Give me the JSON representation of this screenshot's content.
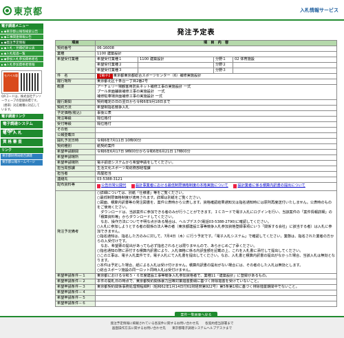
{
  "header": {
    "org": "東京都",
    "service": "入札情報サービス"
  },
  "sidebar": {
    "section1": "電子調達メニュー",
    "items": [
      "◆東京都公報等検索公告",
      "◆工事関連情報公告",
      "◆発注予定情報",
      "◆入札・見積結果公表",
      "◆入札経過一覧",
      "◆参加入札参加資格者名",
      "◆入札参加資格者情報"
    ],
    "mobile_logo": "モバイル版",
    "mobile_text": "QRコードは、株式会社デンソーウェーブの登録商標です。（携帯）対応機種に対応しています。",
    "section2": "電子調達リンク",
    "buttons": [
      "電子調達システム(TOP)",
      "電 子 入 札",
      "資 格 審 査"
    ],
    "section3": "リンク",
    "links": [
      "東京都財務局総合調達",
      "東京都公報ホームページ"
    ]
  },
  "page_title": "発注予定表",
  "table_head": {
    "c1": "項目",
    "c2": "項　目　内　容"
  },
  "rows": {
    "contract_no": {
      "label": "契約番号",
      "value": "06-16008"
    },
    "category": {
      "label": "業種",
      "value": "1100 建築設計"
    },
    "desired": {
      "label": "希望受付業種",
      "r1": "希望受付業種１",
      "r1v": "1100 建築設計",
      "r2": "希望受付業種２",
      "r3": "希望受付業種３",
      "p1": "分野１",
      "p1v": "02 体育施設",
      "p2": "分野２",
      "p3": "分野３"
    },
    "name": {
      "label": "件　名",
      "tag": "【電子】",
      "value": "東京都東京都総合スポーツセンター（6）補修実施設計"
    },
    "place": {
      "label": "履行場所",
      "value": "東京都北区十条台一丁目2番2号"
    },
    "summary": {
      "label": "概要",
      "l1": "アーチェリー場観客用防失ネット補修工事の実施設計 一式",
      "l2": "プール床面舗装補修工事の実施設計　一式",
      "l3": "補修駐車場床面補修工事の実施設計 一式"
    },
    "period": {
      "label": "履行期間",
      "value": "契約確定の日の翌日から令和6年9月18日まで"
    },
    "method": {
      "label": "契約方法",
      "value": "希望制指名競争入札"
    },
    "price_type": {
      "label": "予定価格(税込)",
      "value": "事後公表"
    },
    "announce": {
      "label": "発注等級",
      "value": "隔位格付"
    },
    "ordering": {
      "label": "受付等級",
      "value": "隔位格付"
    },
    "other": {
      "label": "その他",
      "value": ""
    },
    "pub_date": {
      "label": "公報登載日",
      "value": ""
    },
    "open_date": {
      "label": "開札予定日時",
      "value": "令和6年7月11日 10時00分"
    },
    "bid_type": {
      "label": "契約種別",
      "value": "紙契約案件"
    },
    "apply_period": {
      "label": "希望申請期間",
      "value": "令和6年6月17日 9時00分から令和6年6月21日 17時00分"
    },
    "apply_place": {
      "label": "希望申請場所",
      "value": ""
    },
    "apply_method": {
      "label": "希望申請場所",
      "value": "電子調達システムから希望申請をしてください。"
    },
    "dept": {
      "label": "担当局部課",
      "value": "生活文化スポーツ局総務部経理課"
    },
    "contact": {
      "label": "担当者",
      "value": "周屋担当"
    },
    "tel": {
      "label": "連絡先",
      "value": "03-5388-3121"
    },
    "docs": {
      "label": "配布資料等",
      "d1": "公告日常公開代",
      "d2": "設計事業者における最低制限価格制度の本格実施について",
      "d3": "設計業者に係る積算内訳書の提出について"
    },
    "notes": {
      "label": "発注予定備考",
      "lines": [
        "○詳細については、別紙「仕様書」等をご覧ください。",
        "○最低制限価格制度が適用されます。詳細は別紙をご覧ください。",
        "○図面、積算内訳書等の発注図書を、案件公表時から公表します。資格確認結果通知又は指名通知時には原則再度送付いたしません。公表時のものをご使用ください。",
        "　ダウンロードは、当該案件に参加できる者のみが行うことができます。ＩＣカードで電子入札にログインを行い、当該案件の「案件情報詳細」の「積算資料等」からダウンロードしてください。",
        "　なお、操作方法について不明な点がある場合は、ヘルプデスク(電話03-5388-2790)に確認してください。",
        "○入札に参加しようとする者の関係の法人等の者（東京都建設工事等競争入札参加資格登録事項にいう「関係する会社」に該当する者）は入札に参加できません。",
        "○指名通知は、指名した方のみに対して、7月4日（木）に行う予定です。「電子入札システム」で確認してください。業態は、指名された業者の方からの入受付けです。",
        "　なお、希望票の提出があっても必ず指名されるとは限りませんので、あらかじめご了承ください。",
        "○指名通知の際に添付する積算内訳書により、入札価格に係る内訳金額を記載の上、これを入札書に添付して提出してください。",
        "○この工事は、電子入札案件です。電子入札にて入札書を提出してください。なお、入札書と積算内訳書の提出がなかった場合、当該入札は無効となります。",
        "○本件は予定した場合、紙による入札は受け付けません。積算内訳書の提出がない場合には、その者のした入札は無効とします。",
        "○総合スポーツ施設の同一ロット同時入札は受付けません。"
      ]
    },
    "req1": {
      "label": "希望申請条件－１",
      "value": "東京都における令和５・６年度建設工事等競争入札参加資格者で、業種11「建築設計」に登録があるもの。"
    },
    "req2": {
      "label": "希望申請条件－２",
      "value": "本件の開札日の時点で、東京都契約関係暴力団等対策措置要綱に基づく排除措置を受けていないこと。"
    },
    "req3": {
      "label": "希望申請条件－３",
      "value": "東京都契約関係事務処理規程細則（昭和62年1月14日付61財経庶第922号）第5条第1項に基づく排除措置期間中でないこと。"
    },
    "req4": {
      "label": "希望申請条件－４",
      "value": ""
    },
    "req5": {
      "label": "希望申請条件－５",
      "value": ""
    },
    "req6": {
      "label": "希望申請条件－６",
      "value": ""
    }
  },
  "back_button": "案件一覧画面へ戻る",
  "footer": {
    "l1": "発注予定情報に掲載されている各案件に関するお問い合わせ先　　各契約担当部署まで",
    "l2": "画面操作方法に関するお問い合わせ先　　東京都電子調達システムヘルプデスクまで"
  }
}
